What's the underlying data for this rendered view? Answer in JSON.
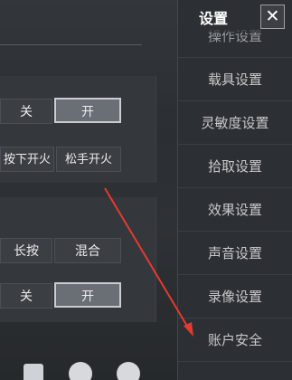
{
  "left": {
    "row1": {
      "off": "关",
      "on": "开"
    },
    "row2": {
      "press_fire": "按下开火",
      "release_fire": "松手开火"
    },
    "row3": {
      "hold": "长按",
      "mixed": "混合"
    },
    "row4": {
      "off": "关",
      "on": "开"
    }
  },
  "sidebar": {
    "title": "设置",
    "close_symbol": "✕",
    "items": [
      {
        "label": "操作设置"
      },
      {
        "label": "载具设置"
      },
      {
        "label": "灵敏度设置"
      },
      {
        "label": "拾取设置"
      },
      {
        "label": "效果设置"
      },
      {
        "label": "声音设置"
      },
      {
        "label": "录像设置"
      },
      {
        "label": "账户安全"
      }
    ]
  },
  "annotation": {
    "arrow_color": "#e53a2f"
  }
}
